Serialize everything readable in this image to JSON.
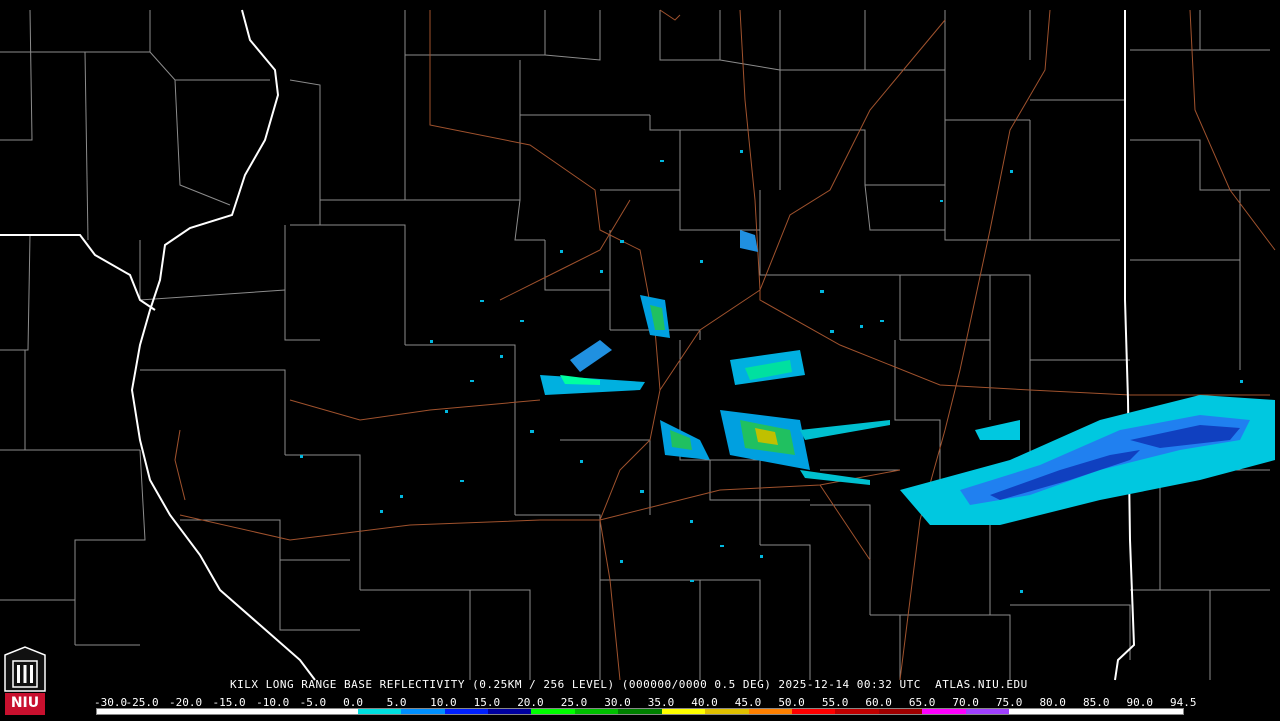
{
  "product": {
    "caption": "KILX LONG RANGE BASE REFLECTIVITY (0.25KM / 256 LEVEL) (000000/0000 0.5 DEG) 2025-12-14 00:32 UTC  ATLAS.NIU.EDU",
    "logo_text": "NIU"
  },
  "legend": {
    "scale_labels": [
      "-30.0",
      "-25.0",
      "-20.0",
      "-15.0",
      "-10.0",
      "-5.0",
      "0.0",
      "5.0",
      "10.0",
      "15.0",
      "20.0",
      "25.0",
      "30.0",
      "35.0",
      "40.0",
      "45.0",
      "50.0",
      "55.0",
      "60.0",
      "65.0",
      "70.0",
      "75.0",
      "80.0",
      "85.0",
      "90.0",
      "94.5"
    ],
    "colors": [
      "#ffffff",
      "#ffffff",
      "#ffffff",
      "#ffffff",
      "#ffffff",
      "#ffffff",
      "#00e0e0",
      "#0090ff",
      "#0020ff",
      "#0000a0",
      "#00ff00",
      "#00c000",
      "#008000",
      "#ffff00",
      "#e0c000",
      "#ff8000",
      "#ff0000",
      "#c00000",
      "#a00000",
      "#ff00ff",
      "#a040ff",
      "#ffffff",
      "#ffffff",
      "#ffffff",
      "#ffffff"
    ]
  },
  "colors": {
    "background": "#000000",
    "state_border": "#ffffff",
    "county_border": "#8c8c8c",
    "highway": "#a0522d"
  }
}
